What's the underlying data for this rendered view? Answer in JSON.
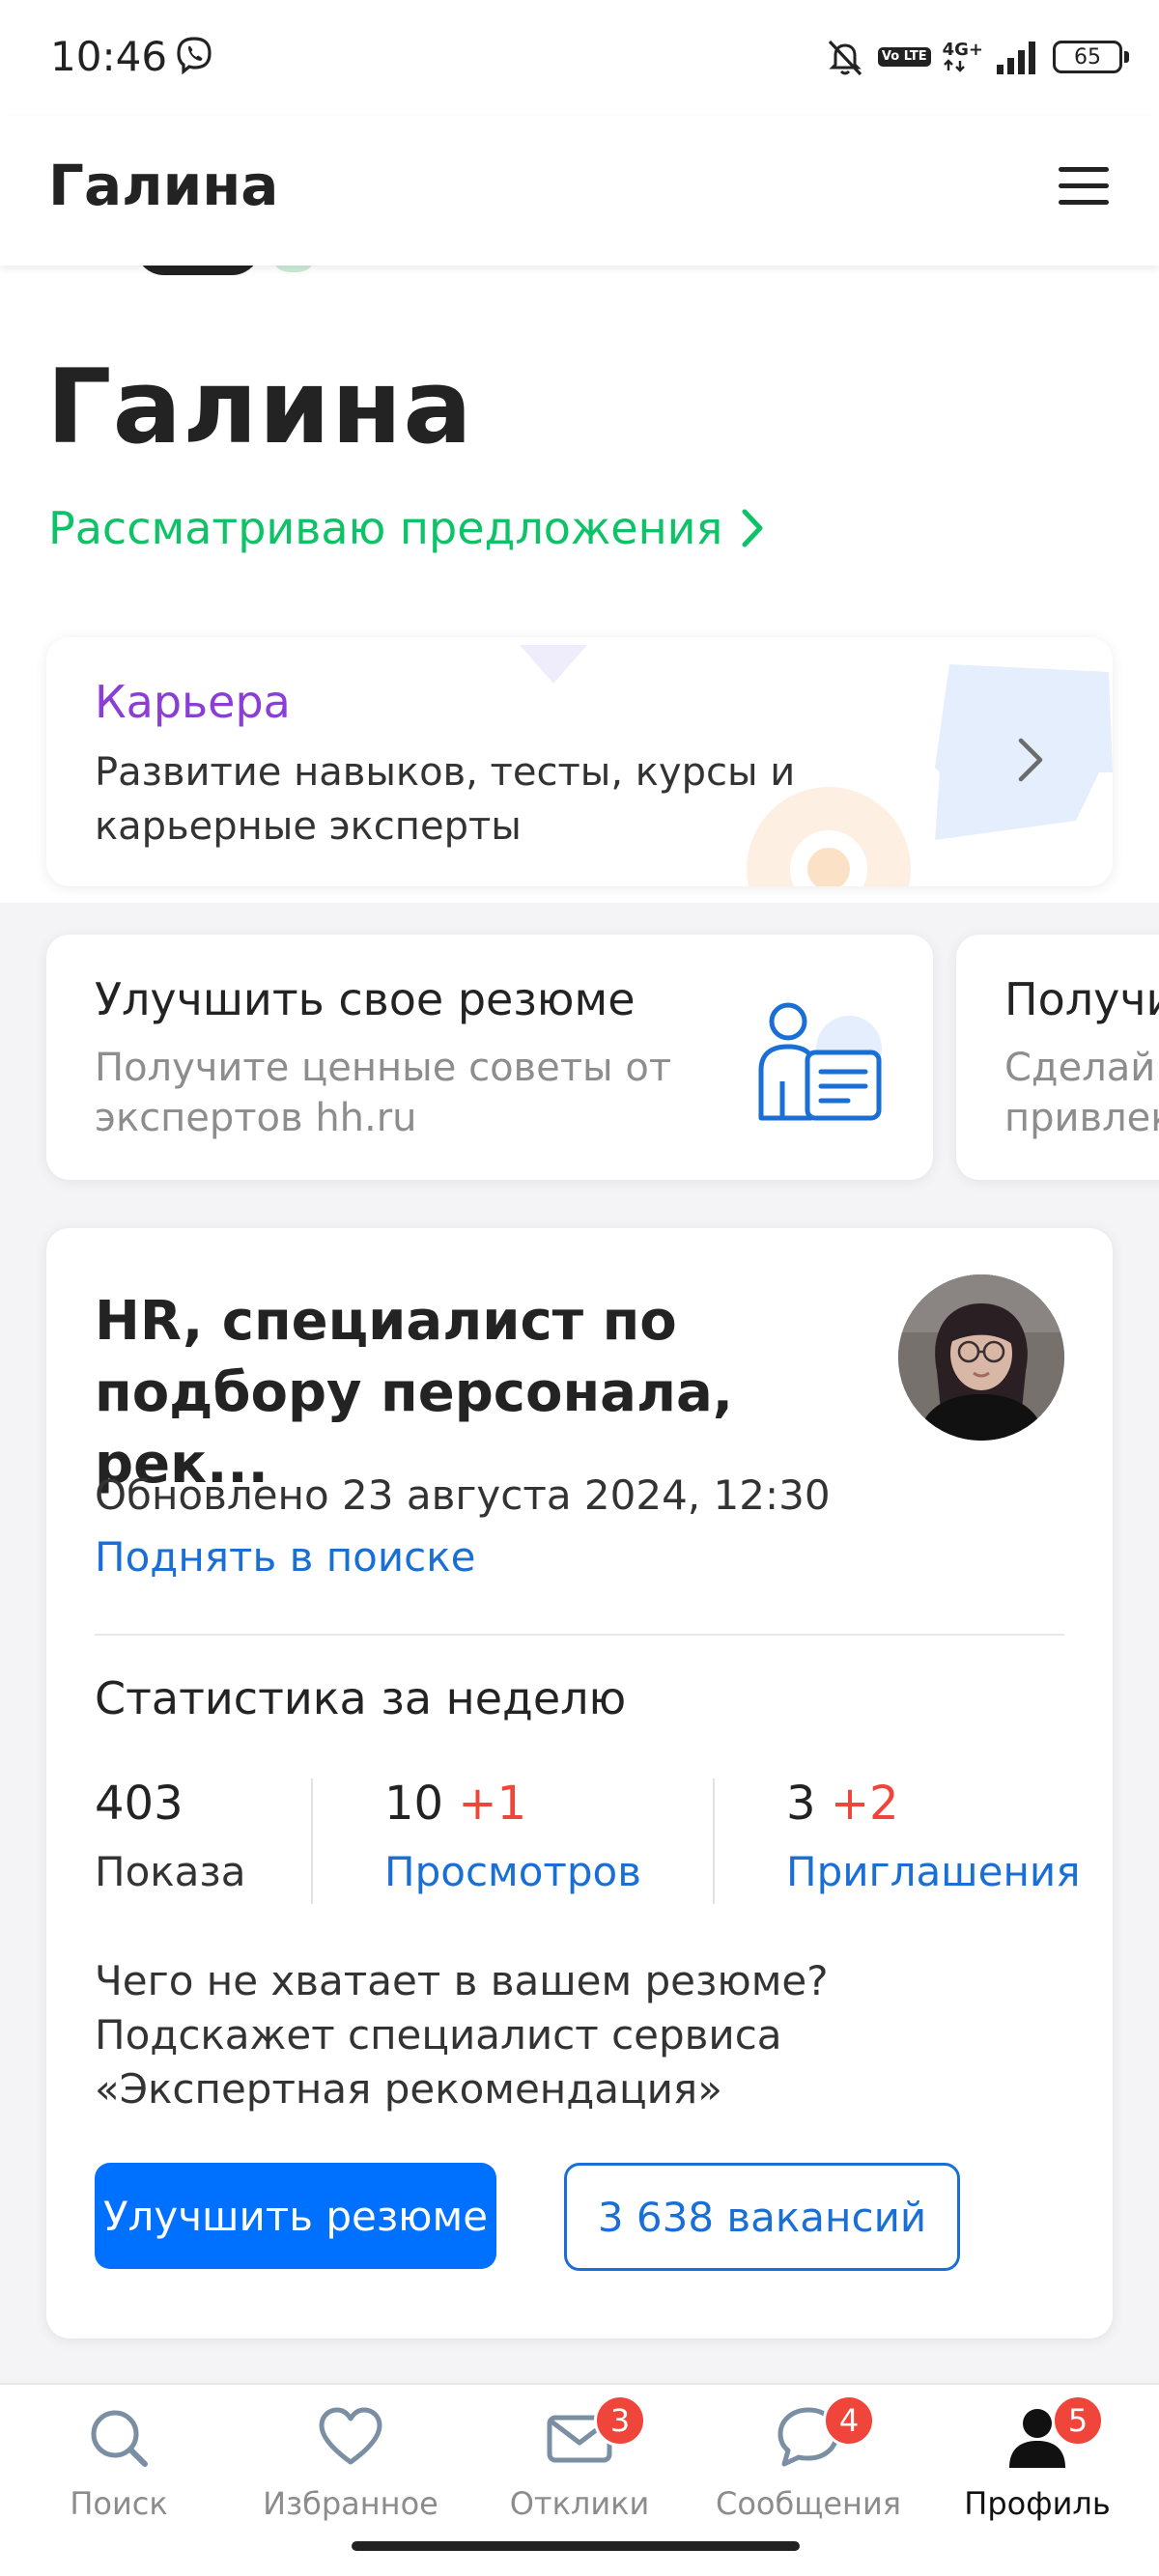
{
  "status_bar": {
    "time": "10:46",
    "network": "4G+",
    "volte": "Vo LTE",
    "battery": "65"
  },
  "header": {
    "title": "Галина"
  },
  "profile": {
    "name": "Галина",
    "job_status": "Рассматриваю предложения"
  },
  "career_card": {
    "title": "Карьера",
    "subtitle": "Развитие навыков, тесты, курсы и карьерные эксперты"
  },
  "promo_cards": [
    {
      "title": "Улучшить свое резюме",
      "subtitle_line1": "Получите ценные советы от",
      "subtitle_line2": "экспертов hh.ru"
    },
    {
      "title": "Получи",
      "subtitle_line1": "Сделай",
      "subtitle_line2": "привлек"
    }
  ],
  "resume": {
    "title": "HR, специалист по подбору персонала, рек...",
    "updated": "Обновлено 23 августа 2024, 12:30",
    "raise_link": "Поднять в поиске",
    "stats_title": "Статистика за неделю",
    "stats": [
      {
        "value": "403",
        "delta": "",
        "label": "Показа"
      },
      {
        "value": "10",
        "delta": "+1",
        "label": "Просмотров"
      },
      {
        "value": "3",
        "delta": "+2",
        "label": "Приглашения"
      }
    ],
    "expert_text": "Чего не хватает в вашем резюме? Подскажет специалист сервиса «Экспертная рекомендация»",
    "improve_button": "Улучшить резюме",
    "vacancies_button": "3 638 вакансий"
  },
  "bottom_nav": [
    {
      "label": "Поиск",
      "icon": "search-icon",
      "badge": ""
    },
    {
      "label": "Избранное",
      "icon": "heart-icon",
      "badge": ""
    },
    {
      "label": "Отклики",
      "icon": "envelope-icon",
      "badge": "3"
    },
    {
      "label": "Сообщения",
      "icon": "chat-bubble-icon",
      "badge": "4"
    },
    {
      "label": "Профиль",
      "icon": "person-icon",
      "badge": "5"
    }
  ],
  "colors": {
    "accent_green": "#0dc267",
    "career_purple": "#8a3ed6",
    "link_blue": "#1a6fd6",
    "primary_button": "#0070ff",
    "badge_red": "#f0453b"
  }
}
